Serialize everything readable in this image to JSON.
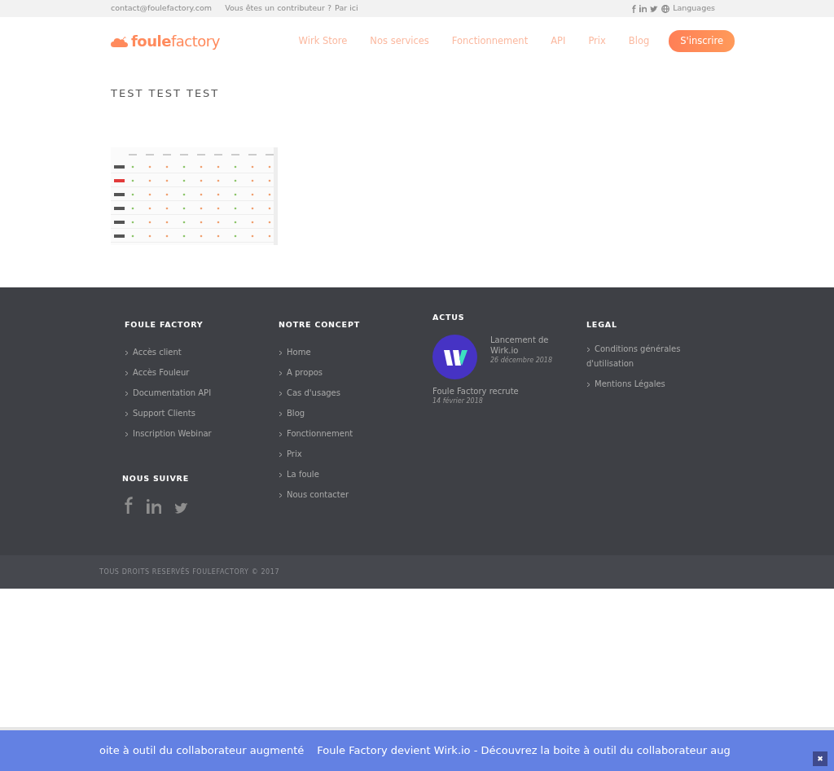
{
  "top_bar": {
    "email": "contact@foulefactory.com",
    "contributor_text": "Vous êtes un contributeur ?",
    "contributor_link": "Par ici",
    "languages": "Languages"
  },
  "header": {
    "logo": "**foule**factory",
    "nav": [
      {
        "label": "Wirk Store"
      },
      {
        "label": "Nos services"
      },
      {
        "label": "Fonctionnement"
      },
      {
        "label": "API"
      },
      {
        "label": "Prix"
      },
      {
        "label": "Blog"
      }
    ],
    "signup": "S'inscrire"
  },
  "page_title": "TEST TEST TEST",
  "footer": {
    "columns": [
      {
        "kind": "links",
        "title": "FOULE FACTORY",
        "links": [
          "Accès client",
          "Accès Fouleur",
          "Documentation API",
          "Support Clients",
          "Inscription Webinar"
        ],
        "follow_title": "NOUS SUIVRE"
      },
      {
        "kind": "links",
        "title": "NOTRE CONCEPT",
        "links": [
          "Home",
          "A propos",
          "Cas d'usages",
          "Blog",
          "Fonctionnement",
          "Prix",
          "La foule",
          "Nous contacter"
        ]
      },
      {
        "kind": "news",
        "title": "ACTUS",
        "items": [
          {
            "title": "Lancement de Wirk.io",
            "date": "26 décembre 2018",
            "thumbnail": true
          },
          {
            "title": "Foule Factory recrute",
            "date": "14 février 2018",
            "thumbnail": false
          }
        ]
      },
      {
        "kind": "links",
        "title": "LEGAL",
        "links": [
          "Conditions générales d'utilisation",
          "Mentions Légales"
        ]
      }
    ],
    "copyright": "TOUS DROITS RESERVÉS FOULEFACTORY © 2017"
  },
  "ticker": {
    "texts": [
      "oite à outil du collaborateur augmenté",
      "Foule Factory devient Wirk.io - Découvrez la boite à outil du collaborateur aug"
    ],
    "close": "✖"
  }
}
